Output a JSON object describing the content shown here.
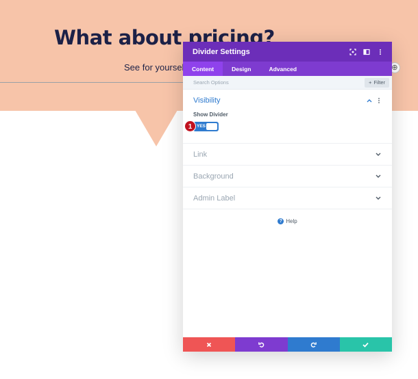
{
  "hero": {
    "title": "What about pricing?",
    "subtitle": "See for yoursel",
    "add_icon": "add-icon",
    "background_color": "#f7c4a9",
    "title_color": "#1c2147"
  },
  "modal": {
    "title": "Divider Settings",
    "header_icons": [
      "expand-icon",
      "sidebar-icon",
      "more-icon"
    ],
    "tabs": [
      {
        "label": "Content",
        "active": true
      },
      {
        "label": "Design",
        "active": false
      },
      {
        "label": "Advanced",
        "active": false
      }
    ],
    "search": {
      "placeholder": "Search Options",
      "value": ""
    },
    "filter_label": "Filter",
    "sections": {
      "visibility": {
        "title": "Visibility",
        "field_label": "Show Divider",
        "toggle_label": "YES",
        "toggle_on": true,
        "badge": "1"
      },
      "link": {
        "title": "Link"
      },
      "background": {
        "title": "Background"
      },
      "admin_label": {
        "title": "Admin Label"
      }
    },
    "help_label": "Help",
    "footer": {
      "cancel_icon": "close-icon",
      "undo_icon": "undo-icon",
      "redo_icon": "redo-icon",
      "save_icon": "check-icon"
    },
    "colors": {
      "header": "#6c2eb9",
      "tabs": "#7e3bd0",
      "accent": "#2f7bcf",
      "cancel": "#ef5555",
      "save": "#29c4a9",
      "badge": "#c1121f"
    }
  }
}
